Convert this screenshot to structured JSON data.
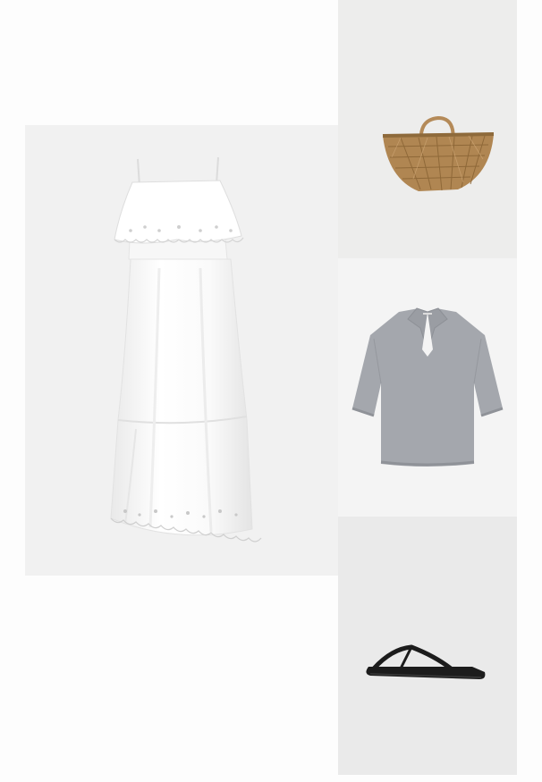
{
  "collage": {
    "items": [
      {
        "id": "dress",
        "icon": "white-eyelet-maxi-dress-icon"
      },
      {
        "id": "bag",
        "icon": "woven-straw-basket-bag-icon"
      },
      {
        "id": "top",
        "icon": "grey-knit-polo-top-icon"
      },
      {
        "id": "sandal",
        "icon": "black-flat-thong-sandal-icon"
      }
    ],
    "colors": {
      "page_background": "#fdfdfd",
      "dress": "#ffffff",
      "straw": "#b08652",
      "knit": "#a4a7ad",
      "sandal": "#1c1c1c"
    }
  }
}
